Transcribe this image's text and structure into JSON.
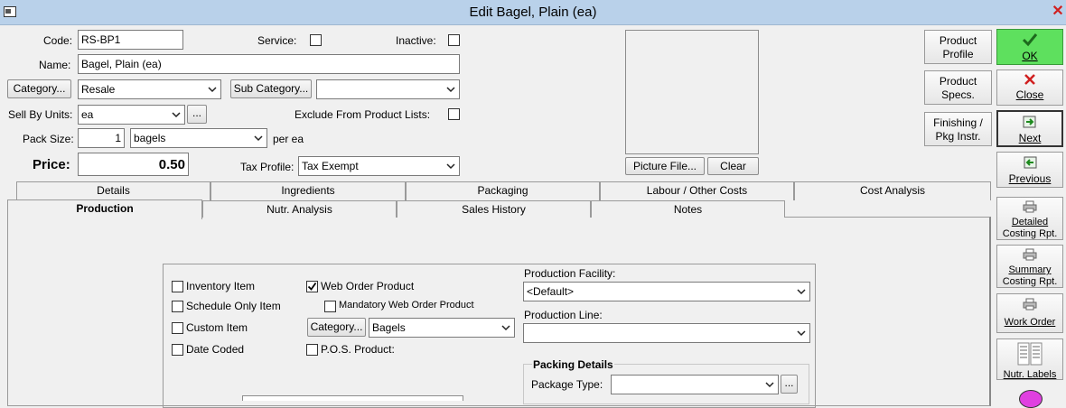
{
  "window": {
    "title": "Edit Bagel, Plain (ea)",
    "close_glyph": "✕"
  },
  "form": {
    "code_label": "Code:",
    "code_value": "RS-BP1",
    "service_label": "Service:",
    "inactive_label": "Inactive:",
    "name_label": "Name:",
    "name_value": "Bagel, Plain (ea)",
    "category_button": "Category...",
    "category_value": "Resale",
    "subcategory_button": "Sub Category...",
    "subcategory_value": "",
    "sell_by_label": "Sell By Units:",
    "sell_by_value": "ea",
    "ellipsis": "...",
    "exclude_label": "Exclude From Product Lists:",
    "pack_size_label": "Pack Size:",
    "pack_size_value": "1",
    "pack_unit_value": "bagels",
    "per_ea": "per ea",
    "price_label": "Price:",
    "price_value": "0.50",
    "tax_label": "Tax Profile:",
    "tax_value": "Tax Exempt",
    "picture_file_button": "Picture File...",
    "clear_button": "Clear"
  },
  "right_buttons": {
    "product_profile": [
      "Product",
      "Profile"
    ],
    "product_specs": [
      "Product",
      "Specs."
    ],
    "finishing": [
      "Finishing /",
      "Pkg Instr."
    ]
  },
  "side_buttons": {
    "ok": "OK",
    "close": "Close",
    "next": "Next",
    "previous": "Previous",
    "detailed": [
      "Detailed",
      "Costing Rpt."
    ],
    "summary": [
      "Summary",
      "Costing Rpt."
    ],
    "work_order": "Work Order",
    "nutr_labels": "Nutr. Labels"
  },
  "tabs_back": [
    "Details",
    "Ingredients",
    "Packaging",
    "Labour / Other Costs",
    "Cost Analysis"
  ],
  "tabs_front": [
    "Production",
    "Nutr. Analysis",
    "Sales History",
    "Notes"
  ],
  "production": {
    "inventory_item": "Inventory Item",
    "schedule_only": "Schedule Only Item",
    "custom_item": "Custom Item",
    "date_coded": "Date Coded",
    "web_order": "Web Order Product",
    "mandatory_web": "Mandatory Web Order Product",
    "category_button": "Category...",
    "category_value": "Bagels",
    "pos_product": "P.O.S. Product:",
    "facility_label": "Production Facility:",
    "facility_value": "<Default>",
    "line_label": "Production Line:",
    "line_value": "",
    "packing_details": "Packing Details",
    "package_type_label": "Package Type:",
    "package_type_value": ""
  },
  "colors": {
    "ok_green": "#5ee05e",
    "title_blue": "#b9d1ea"
  }
}
